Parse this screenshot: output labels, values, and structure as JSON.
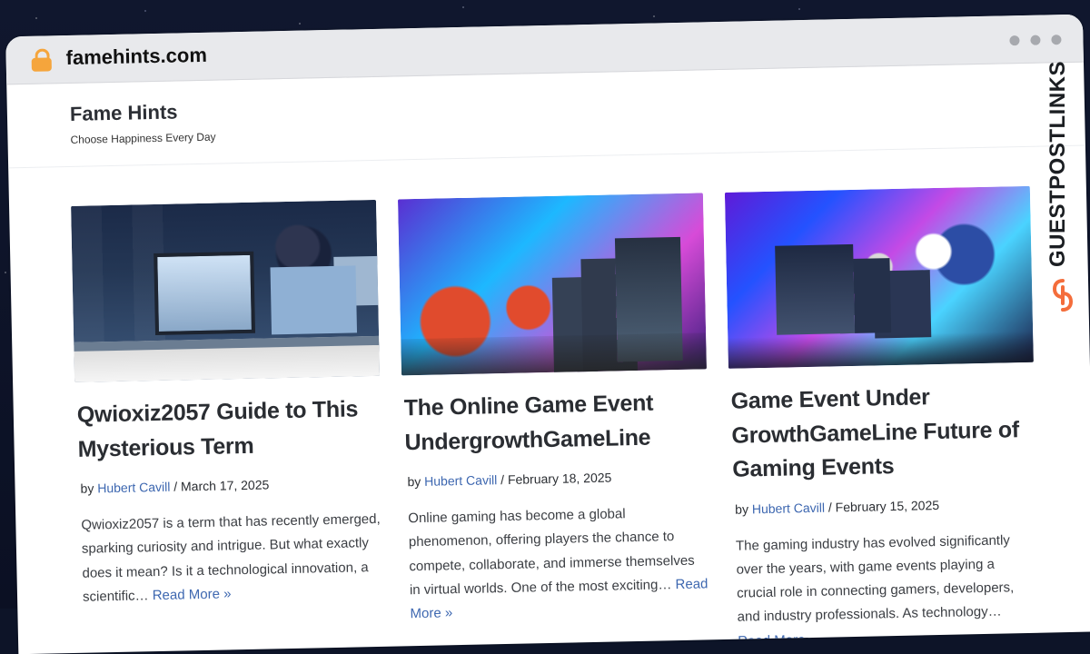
{
  "browser": {
    "url": "famehints.com",
    "window_controls": [
      "control-dot",
      "control-dot",
      "control-dot"
    ]
  },
  "site": {
    "title": "Fame Hints",
    "tagline": "Choose Happiness Every Day"
  },
  "cards": [
    {
      "title": "Qwioxiz2057 Guide to This Mysterious Term",
      "by_label": "by",
      "author": "Hubert Cavill",
      "separator": "/",
      "date": "March 17, 2025",
      "excerpt": "Qwioxiz2057 is a term that has recently emerged, sparking curiosity and intrigue. But what exactly does it mean? Is it a technological innovation, a scientific…",
      "read_more": "Read More »"
    },
    {
      "title": "The Online Game Event UndergrowthGameLine",
      "by_label": "by",
      "author": "Hubert Cavill",
      "separator": "/",
      "date": "February 18, 2025",
      "excerpt": "Online gaming has become a global phenomenon, offering players the chance to compete, collaborate, and immerse themselves in virtual worlds. One of the most exciting…",
      "read_more": "Read More »"
    },
    {
      "title": "Game Event Under GrowthGameLine Future of Gaming Events",
      "by_label": "by",
      "author": "Hubert Cavill",
      "separator": "/",
      "date": "February 15, 2025",
      "excerpt": "The gaming industry has evolved significantly over the years, with game events playing a crucial role in connecting gamers, developers, and industry professionals. As technology…",
      "read_more": "Read More »"
    }
  ],
  "watermark": {
    "text": "GUESTPOSTLINKS"
  },
  "icons": {
    "lock": "lock-icon",
    "brand": "guestpostlinks-logo-icon"
  },
  "colors": {
    "link": "#3d67b0",
    "text": "#2a2d32",
    "watermark_orange": "#f46d3b"
  }
}
